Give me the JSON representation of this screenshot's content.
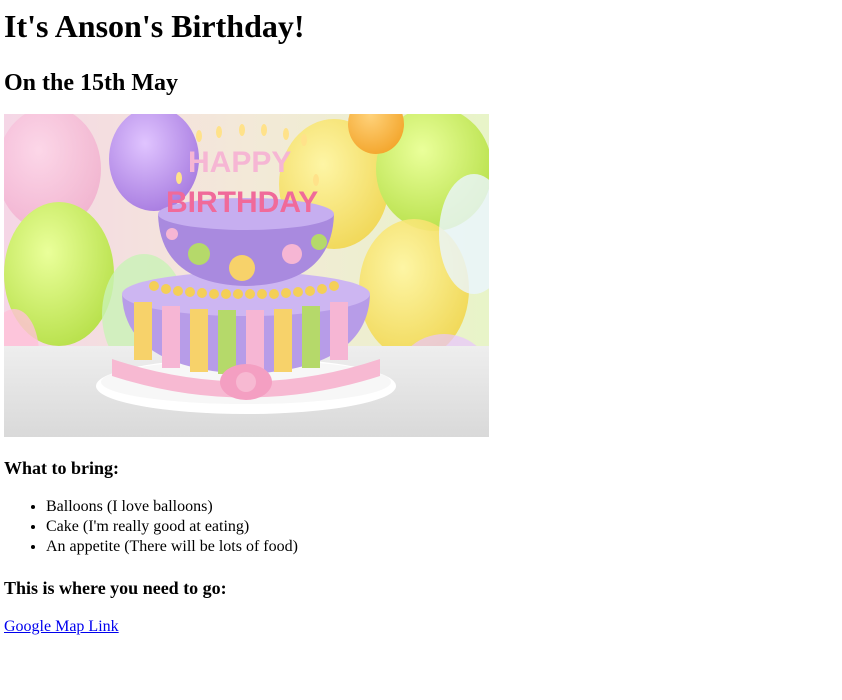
{
  "page": {
    "title": "It's Anson's Birthday!",
    "subtitle": "On the 15th May"
  },
  "image": {
    "cake_text_line1": "HAPPY",
    "cake_text_line2": "BIRTHDAY"
  },
  "bring": {
    "heading": "What to bring:",
    "items": [
      "Balloons (I love balloons)",
      "Cake (I'm really good at eating)",
      "An appetite (There will be lots of food)"
    ]
  },
  "directions": {
    "heading": "This is where you need to go:",
    "link_text": "Google Map Link"
  },
  "colors": {
    "link": "#0000ee",
    "background": "#ffffff"
  }
}
